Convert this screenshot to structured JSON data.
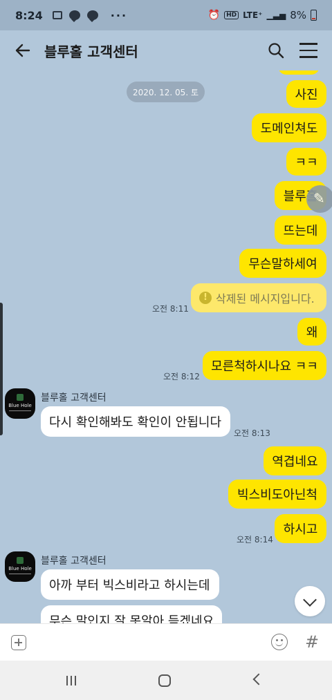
{
  "status_bar": {
    "time": "8:24",
    "network": "LTE⁺",
    "battery": "8%"
  },
  "header": {
    "title": "블루홀 고객센터"
  },
  "chat": {
    "date_divider": "2020. 12. 05. 토",
    "messages": [
      {
        "side": "right",
        "text": "사진"
      },
      {
        "side": "right",
        "text": "도메인쳐도"
      },
      {
        "side": "right",
        "text": "ㅋㅋ"
      },
      {
        "side": "right",
        "text": "블루홀"
      },
      {
        "side": "right",
        "text": "뜨는데"
      },
      {
        "side": "right",
        "text": "무슨말하세여"
      },
      {
        "side": "right",
        "text": "삭제된 메시지입니다.",
        "deleted": true,
        "time": "오전 8:11"
      },
      {
        "side": "right",
        "text": "왜"
      },
      {
        "side": "right",
        "text": "모른척하시나요 ㅋㅋ",
        "time": "오전 8:12"
      },
      {
        "side": "left",
        "sender": "블루홀 고객센터",
        "text": "다시 확인해봐도 확인이 안됩니다",
        "time": "오전 8:13"
      },
      {
        "side": "right",
        "text": "역겹네요"
      },
      {
        "side": "right",
        "text": "빅스비도아닌척"
      },
      {
        "side": "right",
        "text": "하시고",
        "time": "오전 8:14"
      },
      {
        "side": "left",
        "sender": "블루홀 고객센터",
        "text": "아까 부터 빅스비라고 하시는데"
      },
      {
        "side": "left",
        "text": "무슨 말인지 잘 못알아 듣겠네요"
      }
    ],
    "avatar_logo_text": "Blue Hole"
  },
  "input_bar": {
    "hash_label": "#"
  },
  "icons": {
    "back": "arrow-left-icon",
    "search": "search-icon",
    "menu": "hamburger-menu-icon",
    "warning": "warning-icon",
    "edit": "pencil-icon",
    "scroll": "chevron-down-icon",
    "attach": "plus-square-icon",
    "emoji": "emoji-icon"
  },
  "colors": {
    "chat_bg": "#b2c7da",
    "my_bubble": "#fee500",
    "their_bubble": "#ffffff"
  }
}
